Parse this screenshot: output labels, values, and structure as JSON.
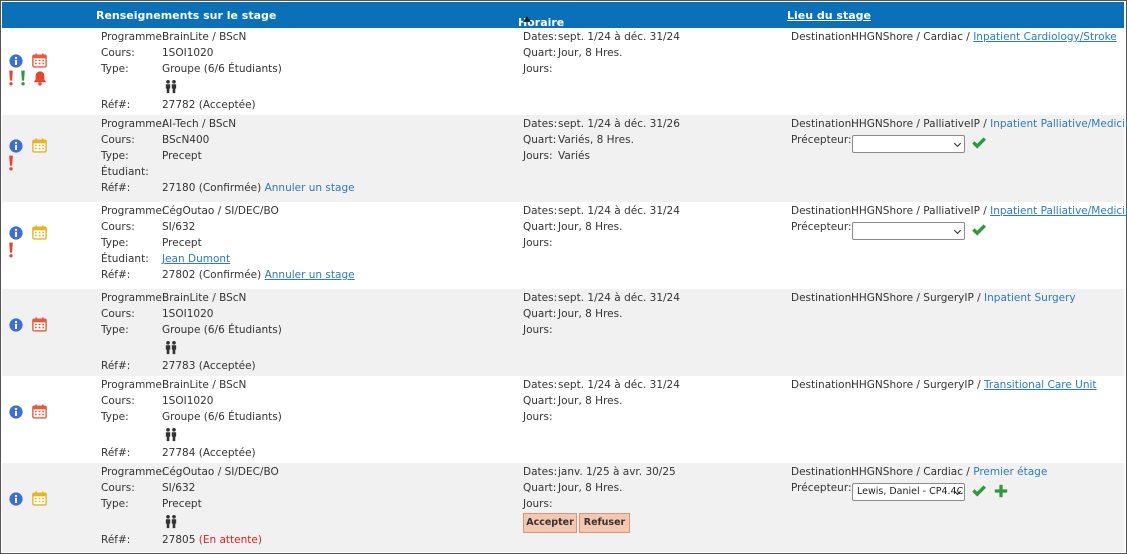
{
  "header": {
    "info_label": "Renseignements sur le stage",
    "schedule_label": "Horaire",
    "site_label": "Lieu du stage"
  },
  "labels": {
    "program": "Programme:",
    "course": "Cours:",
    "type": "Type:",
    "student": "Étudiant:",
    "ref": "Réf#:",
    "dates": "Dates:",
    "shift": "Quart:",
    "days": "Jours:",
    "destination": "Destination:",
    "preceptor": "Précepteur:"
  },
  "rows": [
    {
      "program": "BrainLite / BScN",
      "course": "1SOI1020",
      "type": "Groupe (6/6 Étudiants)",
      "ref": "27782 (Acceptée)",
      "dates": "sept. 1/24 à déc. 31/24",
      "shift": "Jour, 8 Hres.",
      "dest_prefix": "HHGNShore / Cardiac / ",
      "dest_link": "Inpatient Cardiology/Stroke"
    },
    {
      "program": "AI-Tech / BScN",
      "course": "BScN400",
      "type": "Precept",
      "ref": "27180 (Confirmée)",
      "ref_action": "Annuler un stage",
      "dates": "sept. 1/24 à déc. 31/26",
      "shift": "Variés, 8 Hres.",
      "days": "Variés",
      "dest_prefix": "HHGNShore / PalliativeIP / ",
      "dest_link": "Inpatient Palliative/Medicine"
    },
    {
      "program": "CégOutao / SI/DEC/BO",
      "course": "SI/632",
      "type": "Precept",
      "student": "Jean Dumont",
      "ref": "27802 (Confirmée)",
      "ref_action": "Annuler un stage",
      "dates": "sept. 1/24 à déc. 31/24",
      "shift": "Jour, 8 Hres.",
      "dest_prefix": "HHGNShore / PalliativeIP / ",
      "dest_link": "Inpatient Palliative/Medicine"
    },
    {
      "program": "BrainLite / BScN",
      "course": "1SOI1020",
      "type": "Groupe (6/6 Étudiants)",
      "ref": "27783 (Acceptée)",
      "dates": "sept. 1/24 à déc. 31/24",
      "shift": "Jour, 8 Hres.",
      "dest_prefix": "HHGNShore / SurgeryIP / ",
      "dest_link": "Inpatient Surgery"
    },
    {
      "program": "BrainLite / BScN",
      "course": "1SOI1020",
      "type": "Groupe (6/6 Étudiants)",
      "ref": "27784 (Acceptée)",
      "dates": "sept. 1/24 à déc. 31/24",
      "shift": "Jour, 8 Hres.",
      "dest_prefix": "HHGNShore / SurgeryIP / ",
      "dest_link": "Transitional Care Unit"
    },
    {
      "program": "CégOutao / SI/DEC/BO",
      "course": "SI/632",
      "type": "Precept",
      "ref_number": "27805",
      "ref_status": "(En attente)",
      "dates": "janv. 1/25 à avr. 30/25",
      "shift": "Jour, 8 Hres.",
      "dest_prefix": "HHGNShore / Cardiac / ",
      "dest_link": "Premier étage",
      "preceptor_value": "Lewis, Daniel - CP4.4C",
      "accept_label": "Accepter",
      "refuse_label": "Refuser"
    }
  ],
  "icons": {
    "info": "info-icon",
    "calendar": "calendar-icon",
    "alert": "exclamation-icon",
    "bell": "bell-icon",
    "group": "group-students-icon",
    "confirm": "checkmark-icon",
    "add": "plus-icon"
  },
  "colors": {
    "header_bg": "#0a70b8",
    "info_blue": "#3c6fd6",
    "calendar_red": "#e85a3c",
    "calendar_yellow": "#e7b422",
    "alert_red": "#e8452a",
    "alert_green": "#2f9a3c",
    "check_green": "#2f9a3c",
    "link_blue": "#2a7bbf",
    "pending_red": "#e02020",
    "button_bg": "#f5c6b0"
  }
}
